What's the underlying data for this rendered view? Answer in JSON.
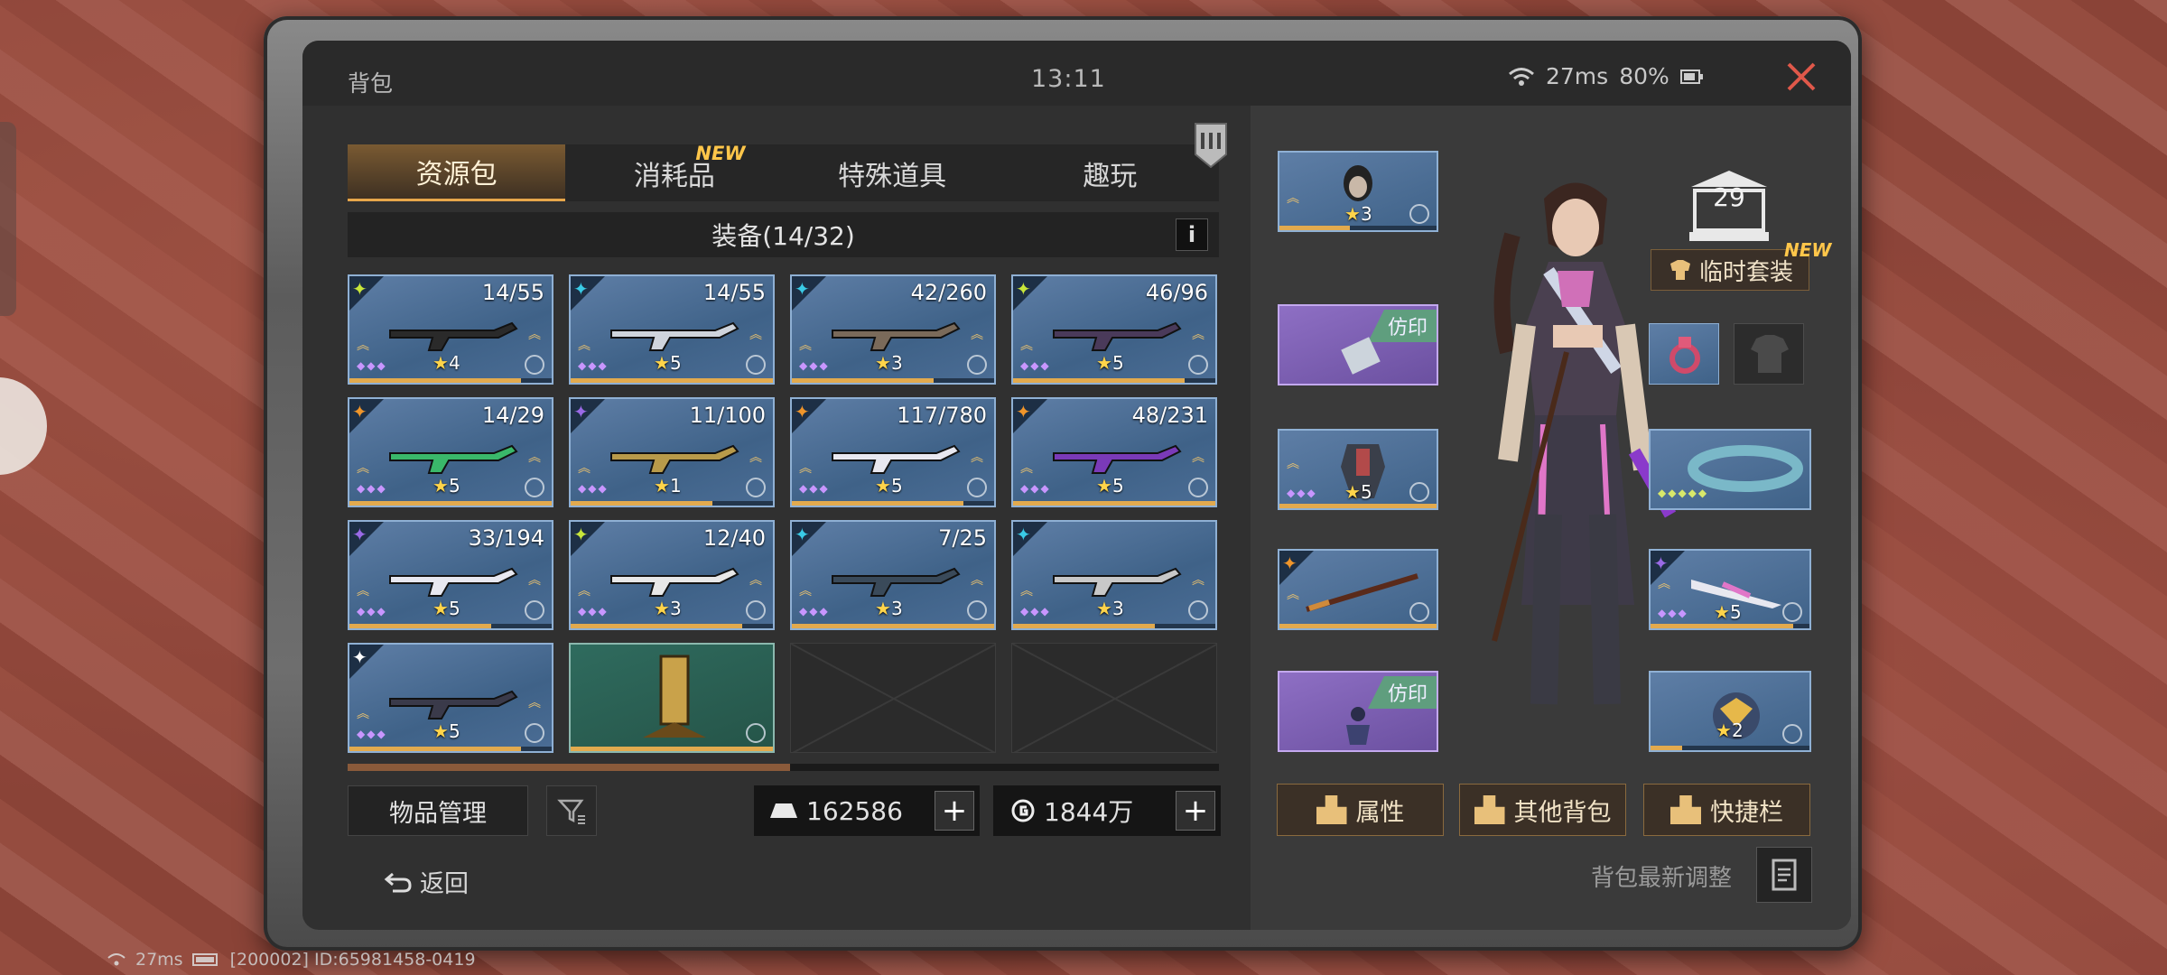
{
  "header": {
    "title": "背包",
    "time": "13:11",
    "ping": "27ms",
    "battery": "80%"
  },
  "tabs": [
    {
      "label": "资源包",
      "active": true
    },
    {
      "label": "消耗品",
      "badge": "NEW"
    },
    {
      "label": "特殊道具"
    },
    {
      "label": "趣玩"
    }
  ],
  "section": {
    "title": "装备(14/32)",
    "info": "i"
  },
  "items": [
    {
      "count": "14/55",
      "stars": "4",
      "corner": "#c8e63a"
    },
    {
      "count": "14/55",
      "stars": "5",
      "corner": "#3acbe6"
    },
    {
      "count": "42/260",
      "stars": "3",
      "corner": "#3acbe6"
    },
    {
      "count": "46/96",
      "stars": "5",
      "corner": "#c8e63a"
    },
    {
      "count": "14/29",
      "stars": "5",
      "corner": "#f0952a"
    },
    {
      "count": "11/100",
      "stars": "1",
      "corner": "#9a6ae6"
    },
    {
      "count": "117/780",
      "stars": "5",
      "corner": "#f0952a"
    },
    {
      "count": "48/231",
      "stars": "5",
      "corner": "#f0952a"
    },
    {
      "count": "33/194",
      "stars": "5",
      "corner": "#9a6ae6"
    },
    {
      "count": "12/40",
      "stars": "3",
      "corner": "#c8e63a"
    },
    {
      "count": "7/25",
      "stars": "3",
      "corner": "#3acbe6"
    },
    {
      "count": "",
      "stars": "3",
      "corner": "#3acbe6"
    },
    {
      "count": "",
      "stars": "5",
      "corner": "#ffffff"
    }
  ],
  "bottom": {
    "manage": "物品管理",
    "currency1": "162586",
    "currency2": "1844万",
    "plus": "+",
    "back": "返回"
  },
  "equipment": {
    "seal1": "仿印",
    "seal2": "仿印",
    "slot_top_stars": "3",
    "slot3_stars": "5",
    "slot_right_weapon_stars": "5",
    "slot_bottom_right_stars": "2",
    "rank": "29",
    "temp_set": "临时套装",
    "temp_badge": "NEW"
  },
  "actions": {
    "attributes": "属性",
    "other_bags": "其他背包",
    "shortcut": "快捷栏"
  },
  "latest": "背包最新调整",
  "footer": {
    "ping": "27ms",
    "id": "[200002] ID:65981458-0419"
  },
  "colors": {
    "accent": "#e2aa4e",
    "rarity_blue": "#4b6d95",
    "seal_purple": "#8e6fc4"
  }
}
